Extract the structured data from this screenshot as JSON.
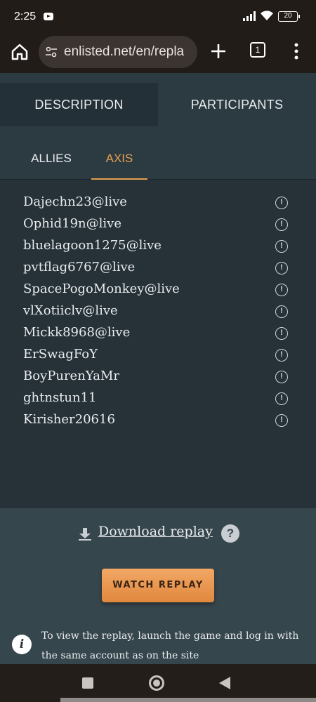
{
  "status_bar": {
    "time": "2:25",
    "battery": "20",
    "icons": [
      "youtube-icon",
      "signal-icon",
      "wifi-icon",
      "battery-icon"
    ]
  },
  "browser": {
    "url": "enlisted.net/en/repla",
    "tab_count": "1",
    "icons": [
      "home-icon",
      "site-settings-icon",
      "new-tab-icon",
      "tab-switcher-icon",
      "menu-icon"
    ]
  },
  "tabs": {
    "description": "DESCRIPTION",
    "participants": "PARTICIPANTS"
  },
  "subtabs": {
    "allies": "ALLIES",
    "axis": "AXIS",
    "active": "axis"
  },
  "players": [
    "Dajechn23@live",
    "Ophid19n@live",
    "bluelagoon1275@live",
    "pvtflag6767@live",
    "SpacePogoMonkey@live",
    "vlXotiiclv@live",
    "Mickk8968@live",
    "ErSwagFoY",
    "BoyPurenYaMr",
    "ghtnstun11",
    "Kirisher20616"
  ],
  "info_symbol": "!",
  "download": {
    "label": "Download replay",
    "help": "?"
  },
  "watch_button": "WATCH REPLAY",
  "note": {
    "icon_glyph": "i",
    "text": "To view the replay, launch the game and log in with the same account as on the site"
  },
  "colors": {
    "accent": "#e2a04f",
    "button": "#e8944a",
    "panel": "#263238"
  }
}
